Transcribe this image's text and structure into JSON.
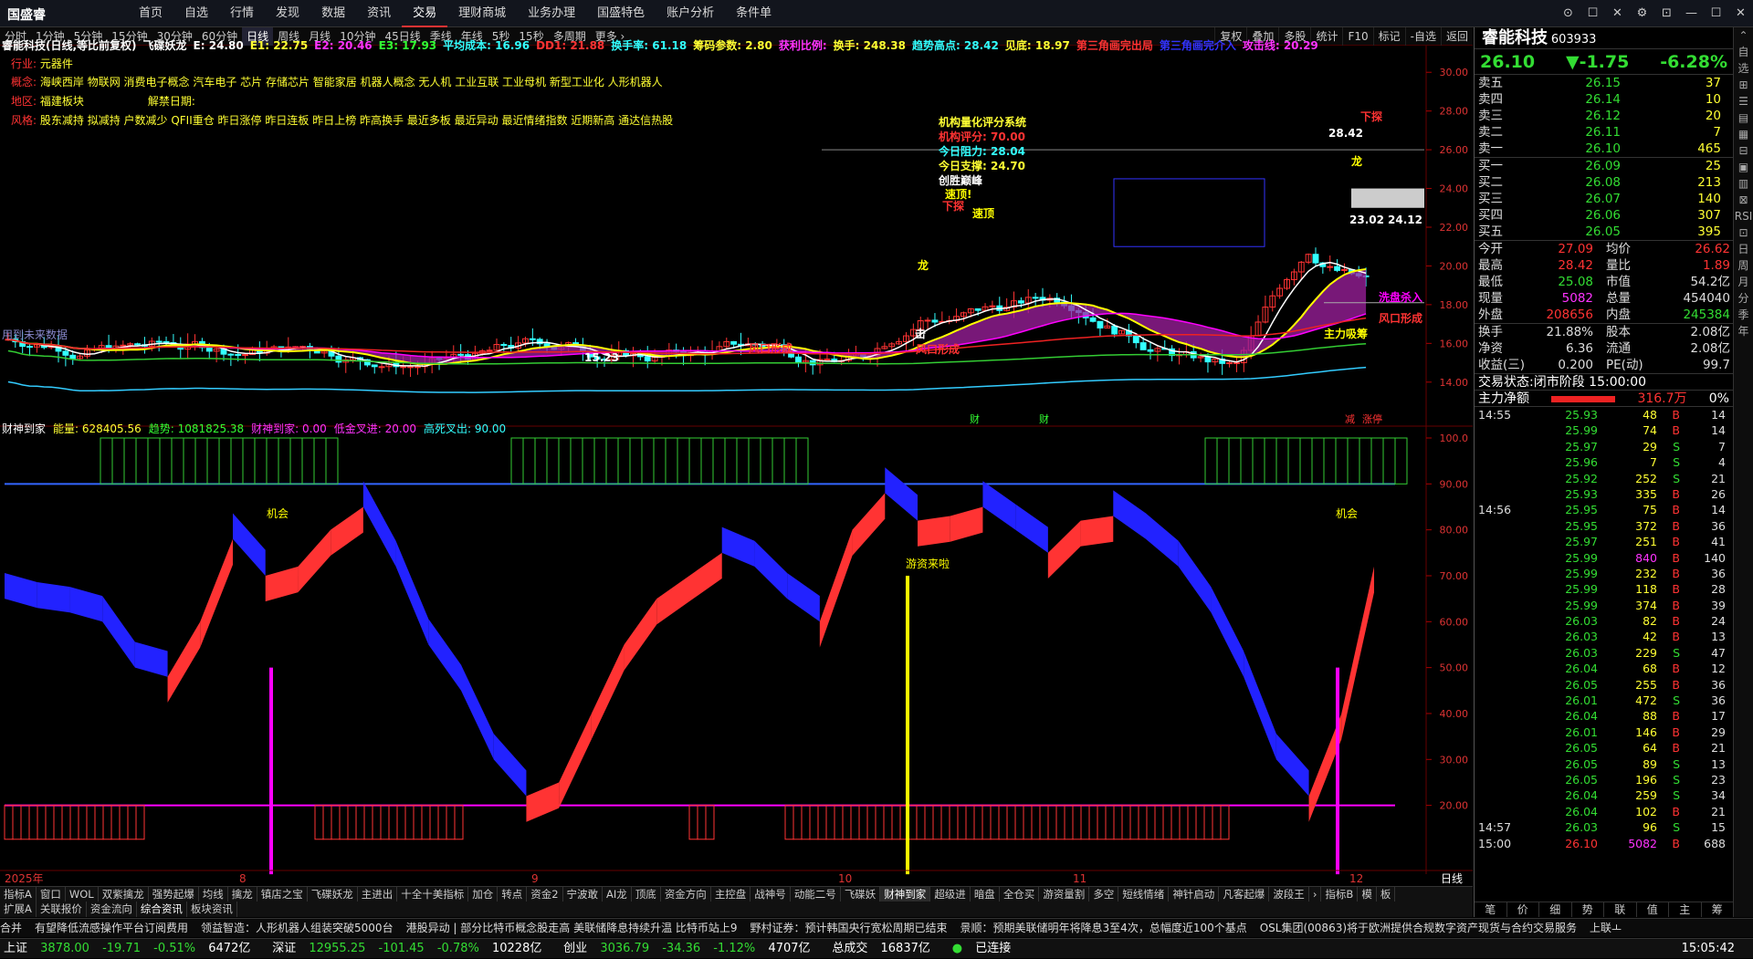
{
  "topbar": {
    "logo": "国盛睿",
    "menu": [
      "首页",
      "自选",
      "行情",
      "发现",
      "数据",
      "资讯",
      "交易",
      "理财商城",
      "业务办理",
      "国盛特色",
      "账户分析",
      "条件单"
    ],
    "active": "交易",
    "win_btns": [
      "⊙",
      "☐",
      "✕",
      "⚙",
      "⊡",
      "—",
      "☐",
      "✕"
    ]
  },
  "period": {
    "items": [
      "分时",
      "1分钟",
      "5分钟",
      "15分钟",
      "30分钟",
      "60分钟",
      "日线",
      "周线",
      "月线",
      "10分钟",
      "45日线",
      "季线",
      "年线",
      "5秒",
      "15秒",
      "多周期",
      "更多 ›"
    ],
    "active": "日线",
    "tools": [
      "复权",
      "叠加",
      "多股",
      "统计",
      "F10",
      "标记",
      "-自选",
      "返回"
    ]
  },
  "main": {
    "header_segments": [
      {
        "t": "睿能科技(日线,等比前复权)",
        "c": "#fff"
      },
      {
        "t": "飞碟妖龙",
        "c": "#fff"
      },
      {
        "t": "E: 24.80",
        "c": "#fff"
      },
      {
        "t": "E1: 22.75",
        "c": "#ffff33"
      },
      {
        "t": "E2: 20.46",
        "c": "#ff33ff"
      },
      {
        "t": "E3: 17.93",
        "c": "#33ff33"
      },
      {
        "t": "平均成本: 16.96",
        "c": "#33ffff"
      },
      {
        "t": "DD1: 21.88",
        "c": "#ff3333"
      },
      {
        "t": "换手率: 61.18",
        "c": "#33ffff"
      },
      {
        "t": "筹码参数: 2.80",
        "c": "#ffff33"
      },
      {
        "t": "获利比例:",
        "c": "#ff33ff"
      },
      {
        "t": "换手: 248.38",
        "c": "#ffff33"
      },
      {
        "t": "趋势高点: 28.42",
        "c": "#33ffff"
      },
      {
        "t": "见底: 18.97",
        "c": "#ffff33"
      },
      {
        "t": "第三角画完出局",
        "c": "#ff3333"
      },
      {
        "t": "第三角画完介入",
        "c": "#3333ff"
      },
      {
        "t": "攻击线: 20.29",
        "c": "#ff33ff"
      }
    ],
    "industry": {
      "label": "行业:",
      "value": "元器件"
    },
    "concept": {
      "label": "概念:",
      "value": "海峡西岸 物联网 消费电子概念 汽车电子 芯片 存储芯片 智能家居 机器人概念 无人机 工业互联 工业母机 新型工业化 人形机器人"
    },
    "region": {
      "label": "地区:",
      "value": "福建板块",
      "lift_label": "解禁日期:"
    },
    "style": {
      "label": "风格:",
      "value": "股东减持 拟减持 户数减少 QFII重仓 昨日涨停 昨日连板 昨日上榜 昨高换手 最近多板 最近异动 最近情绪指数 近期新高 通达信热股"
    },
    "score_box": {
      "title": "机构量化评分系统",
      "score_label": "机构评分:",
      "score": "70.00",
      "pressure_label": "今日阻力:",
      "pressure": "28.04",
      "support_label": "今日支撑:",
      "support": "24.70",
      "note": "创胜巅峰"
    },
    "annotations": [
      "速顶!",
      "速顶",
      "下探",
      "龙",
      "龙",
      "风口形成",
      "风口形成",
      "风口形成",
      "主力吸筹",
      "洗盘杀入",
      "击",
      "28.42",
      "23.02",
      "24.12",
      "15.23",
      "下探"
    ],
    "bottom_labels": [
      "财",
      "财",
      "减",
      "涨停"
    ],
    "y_axis": [
      "30.00",
      "28.00",
      "26.00",
      "24.00",
      "22.00",
      "20.00",
      "18.00",
      "16.00",
      "14.00"
    ],
    "watermark": "用到未来数据"
  },
  "indicator": {
    "title": "财神到家",
    "segments": [
      {
        "t": "能量: 628405.56",
        "c": "#ffff33"
      },
      {
        "t": "趋势: 1081825.38",
        "c": "#33ff33"
      },
      {
        "t": "财神到家: 0.00",
        "c": "#ff33ff"
      },
      {
        "t": "低金叉进: 20.00",
        "c": "#ff33ff"
      },
      {
        "t": "高死叉出: 90.00",
        "c": "#33ffff"
      }
    ],
    "labels": [
      "机会",
      "游资来啦",
      "机会"
    ],
    "y_axis": [
      "100.0",
      "90.00",
      "80.00",
      "70.00",
      "60.00",
      "50.00",
      "40.00",
      "30.00",
      "20.00"
    ],
    "x_axis": [
      "2025年",
      "8",
      "9",
      "10",
      "11",
      "12"
    ],
    "period_label": "日线"
  },
  "chart_data": {
    "type": "candlestick",
    "title": "睿能科技(日线,等比前复权)",
    "x_months": [
      "2025年",
      "8",
      "9",
      "10",
      "11",
      "12"
    ],
    "ylim": [
      13,
      31
    ],
    "price_ticks": [
      30,
      28,
      26,
      24,
      22,
      20,
      18,
      16,
      14
    ],
    "trend_high": 28.42,
    "trend_low": 15.23,
    "last_close": 26.1,
    "oscillator": {
      "ylim": [
        0,
        100
      ],
      "ticks": [
        100,
        90,
        80,
        70,
        60,
        50,
        40,
        30,
        20
      ],
      "buy_line": 20,
      "sell_line": 90
    }
  },
  "tabs1": [
    "指标A",
    "窗口",
    "WOL",
    "双紫擒龙",
    "强势起爆",
    "均线",
    "擒龙",
    "镇店之宝",
    "飞碟妖龙",
    "主进出",
    "十全十美指标",
    "加仓",
    "转点",
    "资金2",
    "宁波敢",
    "AI龙",
    "顶底",
    "资金方向",
    "主控盘",
    "战神号",
    "动能二号",
    "飞碟妖",
    "财神到家",
    "超级进",
    "暗盘",
    "全仓买",
    "游资量割",
    "多空",
    "短线情绪",
    "神针启动",
    "凡客起爆",
    "波段王",
    "›",
    "指标B",
    "模",
    "板"
  ],
  "tabs1_active": "财神到家",
  "tabs2": [
    "扩展A",
    "关联报价",
    "资金流向",
    "综合资讯",
    "板块资讯"
  ],
  "tabs2_active": "综合资讯",
  "news": [
    "合并",
    "有望降低流感操作平台订阅费用",
    "领益智造：人形机器人组装突破5000台",
    "港股异动 | 部分比特币概念股走高 美联储降息持续升温 比特币站上9",
    "野村证券：预计韩国央行宽松周期已结束",
    "景顺：预期美联储明年将降息3至4次，总幅度近100个基点",
    "OSL集团(00863)将于欧洲提供合规数字资产现货与合约交易服务",
    "上联ㅗ"
  ],
  "status": {
    "sh_label": "上证",
    "sh": "3878.00",
    "sh_chg": "-19.71",
    "sh_pct": "-0.51%",
    "sh_amt": "6472亿",
    "sz_label": "深证",
    "sz": "12955.25",
    "sz_chg": "-101.45",
    "sz_pct": "-0.78%",
    "sz_amt": "10228亿",
    "cy_label": "创业",
    "cy": "3036.79",
    "cy_chg": "-34.36",
    "cy_pct": "-1.12%",
    "cy_amt": "4707亿",
    "total_label": "总成交",
    "total": "16837亿",
    "conn": "已连接",
    "time": "15:05:42"
  },
  "quote": {
    "name": "睿能科技",
    "code": "603933",
    "price": "26.10",
    "change": "▼-1.75",
    "pct": "-6.28%",
    "asks": [
      {
        "l": "卖五",
        "p": "26.15",
        "v": "37"
      },
      {
        "l": "卖四",
        "p": "26.14",
        "v": "10"
      },
      {
        "l": "卖三",
        "p": "26.12",
        "v": "20"
      },
      {
        "l": "卖二",
        "p": "26.11",
        "v": "7"
      },
      {
        "l": "卖一",
        "p": "26.10",
        "v": "465"
      }
    ],
    "bids": [
      {
        "l": "买一",
        "p": "26.09",
        "v": "25"
      },
      {
        "l": "买二",
        "p": "26.08",
        "v": "213"
      },
      {
        "l": "买三",
        "p": "26.07",
        "v": "140"
      },
      {
        "l": "买四",
        "p": "26.06",
        "v": "307"
      },
      {
        "l": "买五",
        "p": "26.05",
        "v": "395"
      }
    ],
    "stats": [
      {
        "l1": "今开",
        "v1": "27.09",
        "l2": "均价",
        "v2": "26.62"
      },
      {
        "l1": "最高",
        "v1": "28.42",
        "l2": "量比",
        "v2": "1.89"
      },
      {
        "l1": "最低",
        "v1": "25.08",
        "l2": "市值",
        "v2": "54.2亿"
      },
      {
        "l1": "现量",
        "v1": "5082",
        "l2": "总量",
        "v2": "454040"
      },
      {
        "l1": "外盘",
        "v1": "208656",
        "l2": "内盘",
        "v2": "245384"
      }
    ],
    "stats2": [
      {
        "l1": "换手",
        "v1": "21.88%",
        "l2": "股本",
        "v2": "2.08亿"
      },
      {
        "l1": "净资",
        "v1": "6.36",
        "l2": "流通",
        "v2": "2.08亿"
      },
      {
        "l1": "收益(三)",
        "v1": "0.200",
        "l2": "PE(动)",
        "v2": "99.7"
      }
    ],
    "trade_state_label": "交易状态:",
    "trade_state": "闭市阶段 15:00:00",
    "flow_label": "主力净额",
    "flow": "316.7万",
    "flow_pct": "0%",
    "ticks": [
      {
        "t": "14:55",
        "p": "25.93",
        "v": "48",
        "d": "B",
        "n": "14"
      },
      {
        "t": "",
        "p": "25.99",
        "v": "74",
        "d": "B",
        "n": "14"
      },
      {
        "t": "",
        "p": "25.97",
        "v": "29",
        "d": "S",
        "n": "7"
      },
      {
        "t": "",
        "p": "25.96",
        "v": "7",
        "d": "S",
        "n": "4"
      },
      {
        "t": "",
        "p": "25.92",
        "v": "252",
        "d": "S",
        "n": "21"
      },
      {
        "t": "",
        "p": "25.93",
        "v": "335",
        "d": "B",
        "n": "26"
      },
      {
        "t": "14:56",
        "p": "25.95",
        "v": "75",
        "d": "B",
        "n": "14"
      },
      {
        "t": "",
        "p": "25.95",
        "v": "372",
        "d": "B",
        "n": "36"
      },
      {
        "t": "",
        "p": "25.97",
        "v": "251",
        "d": "B",
        "n": "41"
      },
      {
        "t": "",
        "p": "25.99",
        "v": "840",
        "d": "B",
        "n": "140"
      },
      {
        "t": "",
        "p": "25.99",
        "v": "232",
        "d": "B",
        "n": "36"
      },
      {
        "t": "",
        "p": "25.99",
        "v": "118",
        "d": "B",
        "n": "28"
      },
      {
        "t": "",
        "p": "25.99",
        "v": "374",
        "d": "B",
        "n": "39"
      },
      {
        "t": "",
        "p": "26.03",
        "v": "82",
        "d": "B",
        "n": "24"
      },
      {
        "t": "",
        "p": "26.03",
        "v": "42",
        "d": "B",
        "n": "13"
      },
      {
        "t": "",
        "p": "26.03",
        "v": "229",
        "d": "S",
        "n": "47"
      },
      {
        "t": "",
        "p": "26.04",
        "v": "68",
        "d": "B",
        "n": "12"
      },
      {
        "t": "",
        "p": "26.05",
        "v": "255",
        "d": "B",
        "n": "36"
      },
      {
        "t": "",
        "p": "26.01",
        "v": "472",
        "d": "S",
        "n": "36"
      },
      {
        "t": "",
        "p": "26.04",
        "v": "88",
        "d": "B",
        "n": "17"
      },
      {
        "t": "",
        "p": "26.01",
        "v": "146",
        "d": "B",
        "n": "29"
      },
      {
        "t": "",
        "p": "26.05",
        "v": "64",
        "d": "B",
        "n": "21"
      },
      {
        "t": "",
        "p": "26.05",
        "v": "89",
        "d": "S",
        "n": "13"
      },
      {
        "t": "",
        "p": "26.05",
        "v": "196",
        "d": "S",
        "n": "23"
      },
      {
        "t": "",
        "p": "26.04",
        "v": "259",
        "d": "S",
        "n": "34"
      },
      {
        "t": "",
        "p": "26.04",
        "v": "102",
        "d": "B",
        "n": "21"
      },
      {
        "t": "14:57",
        "p": "26.03",
        "v": "96",
        "d": "S",
        "n": "15"
      },
      {
        "t": "15:00",
        "p": "26.10",
        "v": "5082",
        "d": "B",
        "n": "688"
      }
    ],
    "bottom_tabs": [
      "笔",
      "价",
      "细",
      "势",
      "联",
      "值",
      "主",
      "筹"
    ]
  },
  "sidebar": [
    "⌃",
    "自选",
    "⊞",
    "☰",
    "▤",
    "▦",
    "⊟",
    "▣",
    "▥",
    "⊠",
    "RSI",
    "⊡",
    "日",
    "周",
    "月",
    "分",
    "季",
    "年"
  ]
}
